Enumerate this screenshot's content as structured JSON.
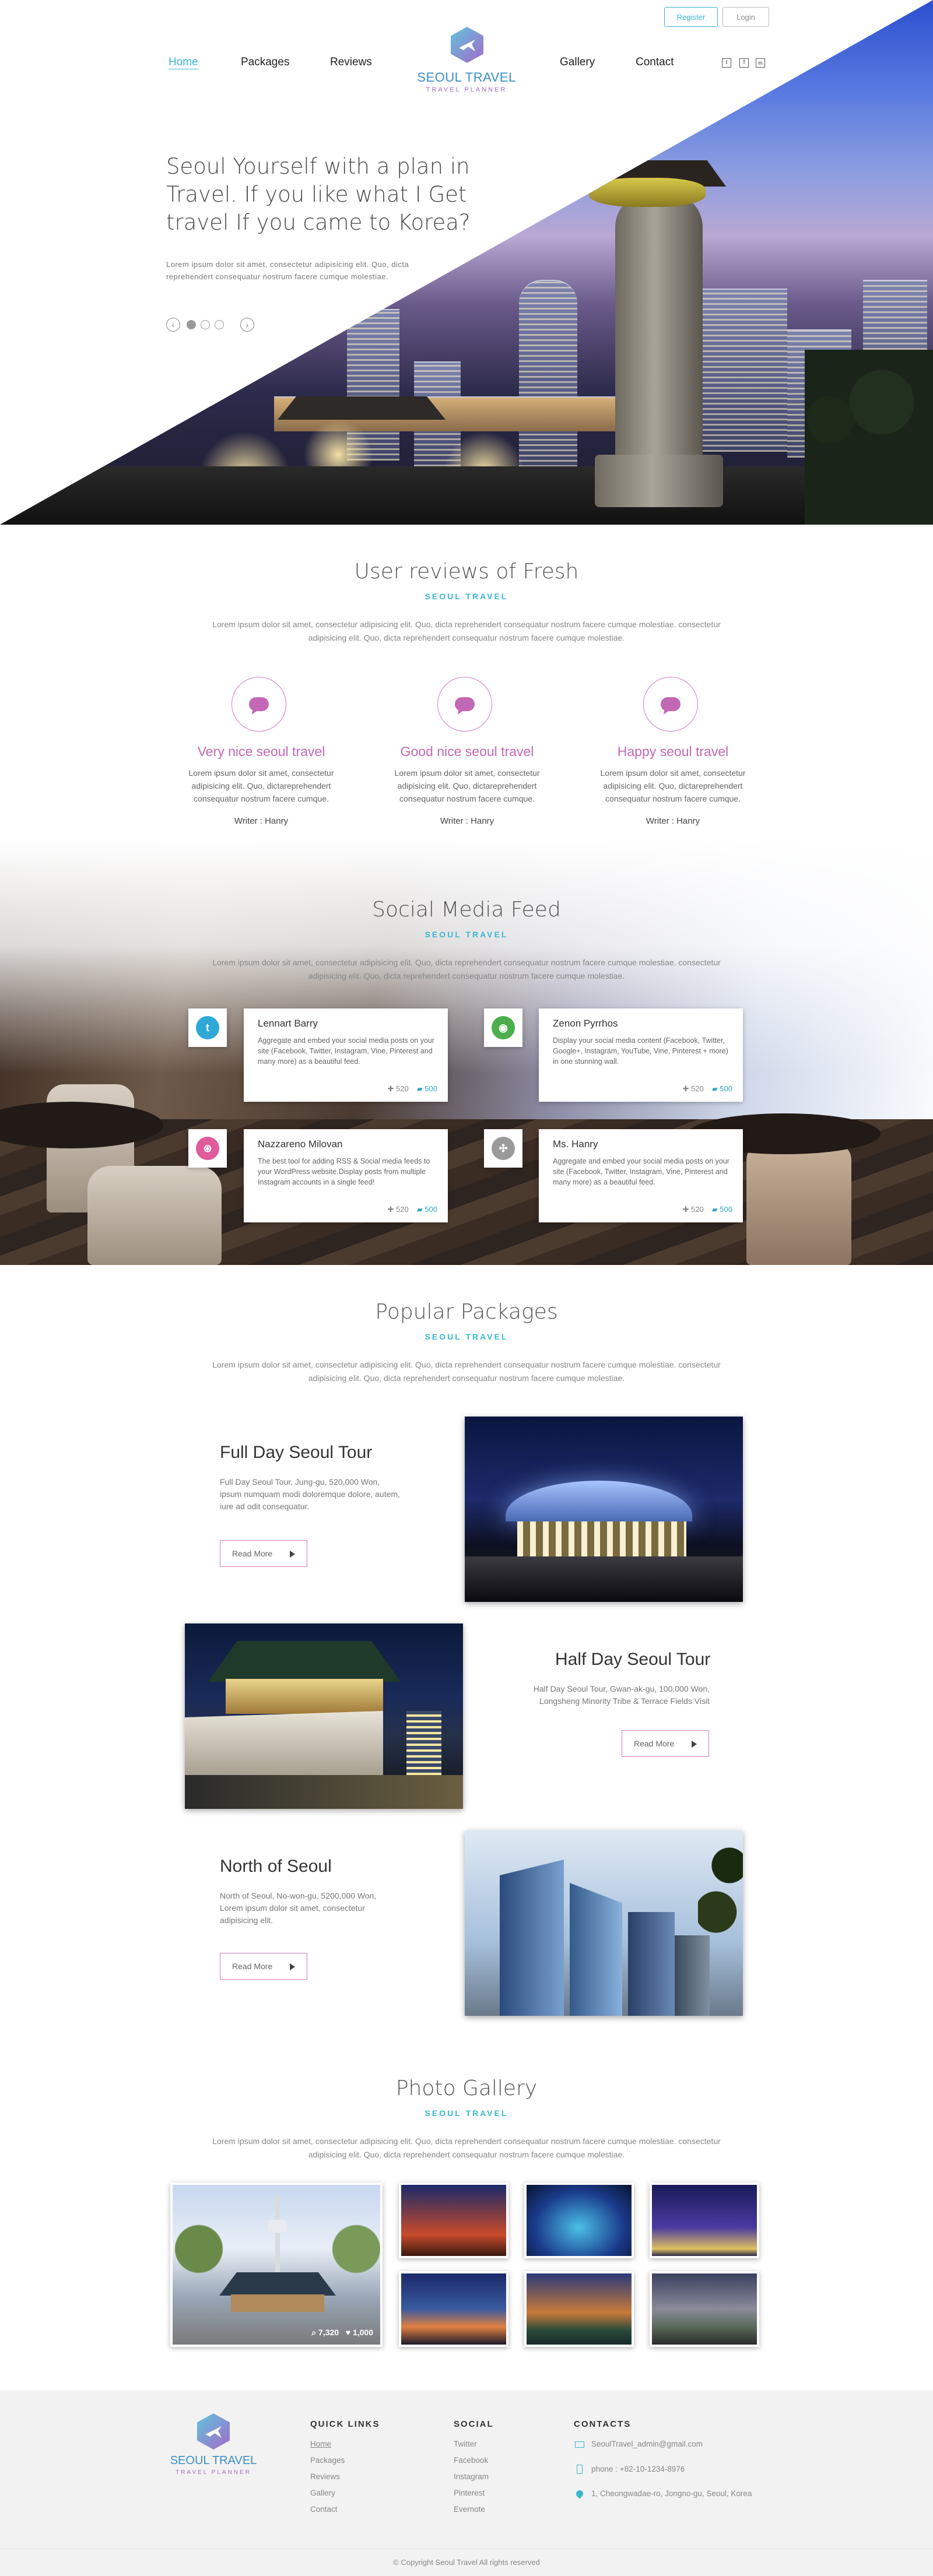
{
  "header": {
    "nav_left": [
      "Home",
      "Packages",
      "Reviews"
    ],
    "nav_right": [
      "Gallery",
      "Contact"
    ],
    "logo_title": "SEOUL TRAVEL",
    "logo_subtitle": "TRAVEL PLANNER",
    "register_label": "Register",
    "login_label": "Login",
    "social_icons": [
      "twitter-icon",
      "facebook-icon",
      "linkedin-icon"
    ]
  },
  "hero": {
    "title": "Seoul Yourself with a plan in Travel. If you like what I Get travel If you came to Korea?",
    "text": "Lorem ipsum dolor sit amet, consectetur adipisicing elit. Quo, dicta reprehendert consequatur nostrum facere cumque molestiae.",
    "slider_dots": 3,
    "active_dot": 0
  },
  "reviews": {
    "title": "User reviews of Fresh",
    "subtitle": "SEOUL TRAVEL",
    "description": "Lorem ipsum dolor sit amet, consectetur adipisicing elit. Quo, dicta reprehendert consequatur nostrum facere cumque molestiae. consectetur adipisicing elit. Quo, dicta reprehendert consequatur nostrum facere cumque molestiae.",
    "items": [
      {
        "title": "Very nice seoul travel",
        "text": "Lorem ipsum dolor sit amet, consectetur adipisicing elit. Quo, dictareprehendert consequatur nostrum facere cumque.",
        "writer": "Writer : Hanry"
      },
      {
        "title": "Good nice seoul travel",
        "text": "Lorem ipsum dolor sit amet, consectetur adipisicing elit. Quo, dictareprehendert consequatur nostrum facere cumque.",
        "writer": "Writer : Hanry"
      },
      {
        "title": "Happy seoul travel",
        "text": "Lorem ipsum dolor sit amet, consectetur adipisicing elit. Quo, dictareprehendert consequatur nostrum facere cumque.",
        "writer": "Writer : Hanry"
      }
    ]
  },
  "social": {
    "title": "Social Media Feed",
    "subtitle": "SEOUL TRAVEL",
    "description": "Lorem ipsum dolor sit amet, consectetur adipisicing elit. Quo, dicta reprehendert consequatur nostrum facere cumque molestiae. consectetur adipisicing elit. Quo, dicta reprehendert consequatur nostrum facere cumque molestiae.",
    "cards": [
      {
        "name": "Lennart Barry",
        "text": "Aggregate and embed your social media posts on your site (Facebook, Twitter, Instagram, Vine, Pinterest and many more) as a beautiful feed.",
        "likes": "520",
        "comments": "500",
        "icon": "twitter-icon",
        "color": "#2fa8d8"
      },
      {
        "name": "Zenon Pyrrhos",
        "text": "Display your social media content (Facebook, Twitter, Google+, Instagram, YouTube, Vine, Pinterest + more) in one stunning wall.",
        "likes": "520",
        "comments": "500",
        "icon": "chat-icon",
        "color": "#4cae4c"
      },
      {
        "name": "Nazzareno Milovan",
        "text": "The best tool for adding RSS & Social media feeds to your WordPress website.Display posts from multiple Instagram accounts in a single feed!",
        "likes": "520",
        "comments": "500",
        "icon": "dribbble-icon",
        "color": "#e05a9c"
      },
      {
        "name": "Ms. Hanry",
        "text": "Aggregate and embed your social media posts on your site (Facebook, Twitter, Instagram, Vine, Pinterest and many more) as a beautiful feed.",
        "likes": "520",
        "comments": "500",
        "icon": "pinwheel-icon",
        "color": "#9a9a9a"
      }
    ]
  },
  "packages": {
    "title": "Popular Packages",
    "subtitle": "SEOUL TRAVEL",
    "description": "Lorem ipsum dolor sit amet, consectetur adipisicing elit. Quo, dicta reprehendert consequatur nostrum facere cumque molestiae. consectetur adipisicing elit. Quo, dicta reprehendert consequatur nostrum facere cumque molestiae.",
    "read_more": "Read More",
    "items": [
      {
        "title": "Full Day Seoul Tour",
        "text": "Full Day Seoul Tour, Jung-gu, 520,000 Won, ipsum numquam modi doloremque dolore, autem, iure ad odit consequatur."
      },
      {
        "title": "Half Day Seoul Tour",
        "text": "Half Day Seoul Tour, Gwan-ak-gu, 100,000 Won, Longsheng Minority Tribe & Terrace Fields Visit"
      },
      {
        "title": "North of Seoul",
        "text": "North of Seoul, No-won-gu, 5200,000 Won, Lorem ipsum dolor sit amet, consectetur adipisicing elit."
      }
    ]
  },
  "gallery": {
    "title": "Photo Gallery",
    "subtitle": "SEOUL TRAVEL",
    "description": "Lorem ipsum dolor sit amet, consectetur adipisicing elit. Quo, dicta reprehendert consequatur nostrum facere cumque molestiae. consectetur adipisicing elit. Quo, dicta reprehendert consequatur nostrum facere cumque molestiae.",
    "views": "7,320",
    "likes": "1,000"
  },
  "footer": {
    "logo_title": "SEOUL TRAVEL",
    "logo_subtitle": "TRAVEL PLANNER",
    "quick_links_title": "QUICK LINKS",
    "quick_links": [
      "Home",
      "Packages",
      "Reviews",
      "Gallery",
      "Contact"
    ],
    "social_title": "SOCIAL",
    "social_links": [
      "Twitter",
      "Facebook",
      "Instagram",
      "Pinterest",
      "Evernote"
    ],
    "contacts_title": "CONTACTS",
    "email": "SeoulTravel_admin@gmail.com",
    "phone": "phone : +82-10-1234-8976",
    "address": "1, Cheongwadae-ro, Jongno-gu, Seoul, Korea",
    "copyright": "© Copyright Seoul Travel All rights reserved"
  },
  "colors": {
    "accent": "#38b8d0",
    "pink": "#c368b4",
    "hero_sky": "#2c4fcf"
  }
}
